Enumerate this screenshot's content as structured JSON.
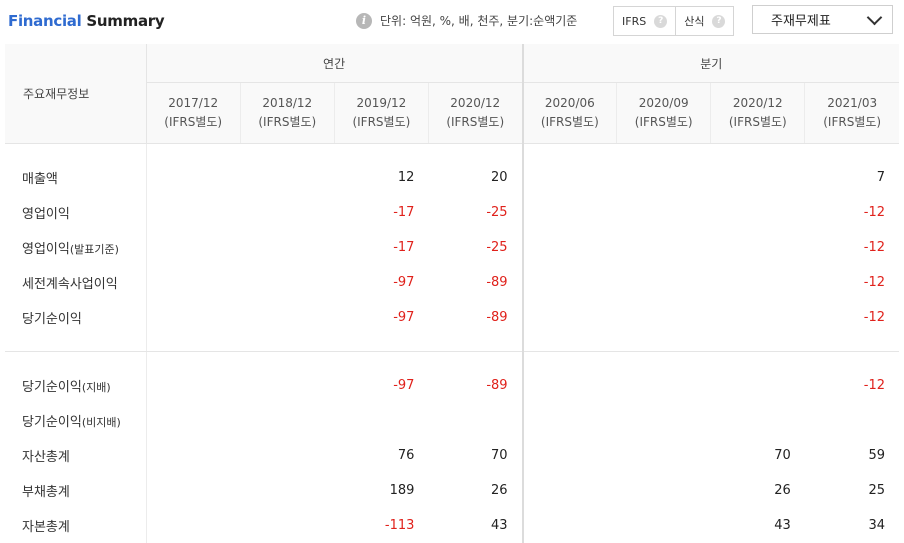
{
  "header": {
    "title_part1": "Financial",
    "title_part2": "Summary",
    "unit_text": "단위: 억원, %, 배, 천주, 분기:순액기준",
    "toggle_ifrs": "IFRS",
    "toggle_calc": "산식",
    "select_value": "주재무제표"
  },
  "table": {
    "corner_label": "주요재무정보",
    "group_annual": "연간",
    "group_quarter": "분기",
    "columns": [
      {
        "period": "2017/12",
        "basis": "(IFRS별도)"
      },
      {
        "period": "2018/12",
        "basis": "(IFRS별도)"
      },
      {
        "period": "2019/12",
        "basis": "(IFRS별도)"
      },
      {
        "period": "2020/12",
        "basis": "(IFRS별도)"
      },
      {
        "period": "2020/06",
        "basis": "(IFRS별도)"
      },
      {
        "period": "2020/09",
        "basis": "(IFRS별도)"
      },
      {
        "period": "2020/12",
        "basis": "(IFRS별도)"
      },
      {
        "period": "2021/03",
        "basis": "(IFRS별도)"
      }
    ],
    "rows": [
      {
        "label": "매출액",
        "sub": "",
        "values": [
          "",
          "",
          "12",
          "20",
          "",
          "",
          "",
          "7"
        ]
      },
      {
        "label": "영업이익",
        "sub": "",
        "values": [
          "",
          "",
          "-17",
          "-25",
          "",
          "",
          "",
          "-12"
        ]
      },
      {
        "label": "영업이익",
        "sub": "(발표기준)",
        "values": [
          "",
          "",
          "-17",
          "-25",
          "",
          "",
          "",
          "-12"
        ]
      },
      {
        "label": "세전계속사업이익",
        "sub": "",
        "values": [
          "",
          "",
          "-97",
          "-89",
          "",
          "",
          "",
          "-12"
        ]
      },
      {
        "label": "당기순이익",
        "sub": "",
        "values": [
          "",
          "",
          "-97",
          "-89",
          "",
          "",
          "",
          "-12"
        ]
      },
      {
        "label": "당기순이익",
        "sub": "(지배)",
        "values": [
          "",
          "",
          "-97",
          "-89",
          "",
          "",
          "",
          "-12"
        ]
      },
      {
        "label": "당기순이익",
        "sub": "(비지배)",
        "values": [
          "",
          "",
          "",
          "",
          "",
          "",
          "",
          ""
        ]
      },
      {
        "label": "자산총계",
        "sub": "",
        "values": [
          "",
          "",
          "76",
          "70",
          "",
          "",
          "70",
          "59"
        ]
      },
      {
        "label": "부채총계",
        "sub": "",
        "values": [
          "",
          "",
          "189",
          "26",
          "",
          "",
          "26",
          "25"
        ]
      },
      {
        "label": "자본총계",
        "sub": "",
        "values": [
          "",
          "",
          "-113",
          "43",
          "",
          "",
          "43",
          "34"
        ]
      }
    ]
  },
  "colors": {
    "accent": "#2f6bd0",
    "negative": "#e0211b"
  }
}
